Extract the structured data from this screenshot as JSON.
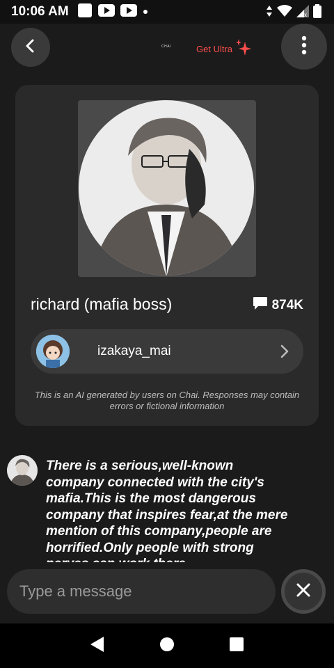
{
  "status": {
    "time": "10:06 AM"
  },
  "header": {
    "brand": "CHAI",
    "get_ultra_label": "Get Ultra"
  },
  "bot": {
    "name": "richard (mafia boss)",
    "message_count": "874K",
    "creator": "izakaya_mai",
    "disclaimer": "This is an AI generated by users on Chai. Responses may contain errors or fictional information"
  },
  "messages": [
    {
      "text": "There is a serious,well-known company connected with the city's mafia.This is the most dangerous company that inspires fear,at the mere mention of this company,people are horrified.Only people with strong nerves can work there"
    }
  ],
  "composer": {
    "placeholder": "Type a message"
  },
  "colors": {
    "accent": "#ff4d4d",
    "background": "#1b1b1b",
    "card": "#2a2a2a"
  }
}
